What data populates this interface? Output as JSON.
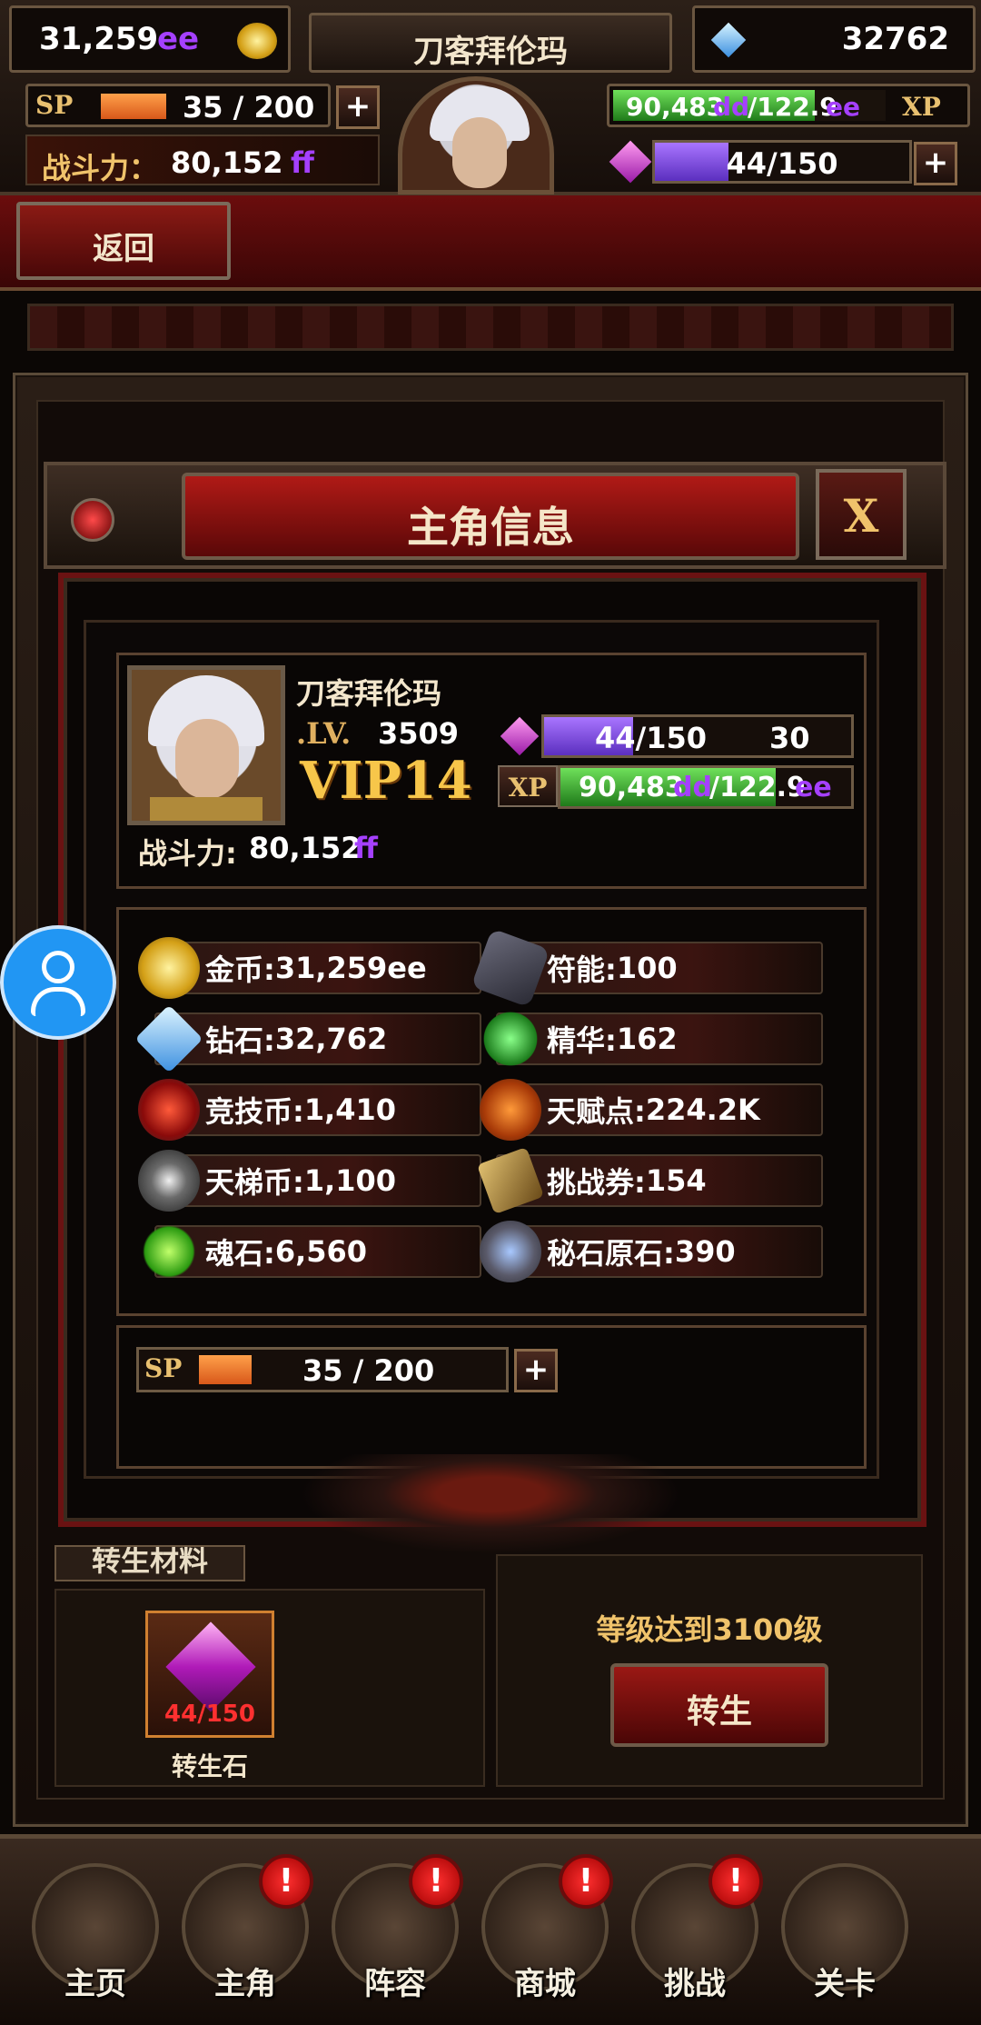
{
  "topbar": {
    "gold": "31,259",
    "gold_suffix": "ee",
    "player_name": "刀客拜伦玛",
    "diamonds": "32762",
    "sp_label": "SP",
    "sp_value": "35 / 200",
    "sp_fill": 0.175,
    "power_label": "战斗力：",
    "power_value": "80,152",
    "power_suffix": "ff",
    "xp_current": "90,483",
    "xp_current_suffix": "dd",
    "xp_max": "/122.9",
    "xp_max_suffix": "ee",
    "xp_label": "XP",
    "xp_fill": 0.74,
    "gem_value": "44/150",
    "gem_fill": 0.29,
    "plus": "+"
  },
  "nav": {
    "back_label": "返回"
  },
  "dialog": {
    "title": "主角信息",
    "close_label": "X",
    "name": "刀客拜伦玛",
    "lv_label": ".LV.",
    "lv_value": "3509",
    "vip_label": "VIP14",
    "gem_value": "44/150",
    "gem_extra": "30",
    "gem_fill": 0.29,
    "xp_label": "XP",
    "xp_current": "90,483",
    "xp_current_suffix": "dd",
    "xp_max": "/122.9",
    "xp_max_suffix": "ee",
    "xp_fill": 0.74,
    "power_label": "战斗力: ",
    "power_value": "80,152",
    "power_suffix": "ff",
    "resources": [
      {
        "label": "金币: ",
        "value": "31,259",
        "suffix": "ee",
        "icon": "gold-coin-icon"
      },
      {
        "label": "符能: ",
        "value": "100",
        "suffix": "",
        "icon": "rune-stone-icon"
      },
      {
        "label": "钻石: ",
        "value": "32,762",
        "suffix": "",
        "icon": "diamond-icon"
      },
      {
        "label": "精华: ",
        "value": "162",
        "suffix": "",
        "icon": "essence-icon"
      },
      {
        "label": "竞技币:",
        "value": "1,410",
        "suffix": "",
        "icon": "arena-coin-icon"
      },
      {
        "label": "天赋点:",
        "value": "224.2",
        "suffix": "K",
        "icon": "talent-point-icon"
      },
      {
        "label": "天梯币:",
        "value": "1,100",
        "suffix": "",
        "icon": "ladder-coin-icon"
      },
      {
        "label": "挑战券:",
        "value": "154",
        "suffix": "",
        "icon": "challenge-ticket-icon"
      },
      {
        "label": "魂石: ",
        "value": "6,560",
        "suffix": "",
        "icon": "soul-stone-icon"
      },
      {
        "label": "秘石原石:",
        "value": "390",
        "suffix": "",
        "icon": "ore-stone-icon"
      }
    ],
    "sp_label": "SP",
    "sp_value": "35 / 200",
    "sp_fill": 0.175,
    "plus": "+"
  },
  "rebirth": {
    "materials_tab": "转生材料",
    "stone_count": "44/150",
    "stone_name": "转生石",
    "requirement": "等级达到3100级",
    "button_label": "转生"
  },
  "bottom_nav": [
    {
      "label": "主页",
      "badge": ""
    },
    {
      "label": "主角",
      "badge": "!"
    },
    {
      "label": "阵容",
      "badge": "!"
    },
    {
      "label": "商城",
      "badge": "!"
    },
    {
      "label": "挑战",
      "badge": "!"
    },
    {
      "label": "关卡",
      "badge": ""
    }
  ],
  "colors": {
    "accent_gold": "#f0c36b",
    "suffix_purple": "#a540ff",
    "suffix_green": "#8bd43a",
    "fab_blue": "#2196f3"
  }
}
